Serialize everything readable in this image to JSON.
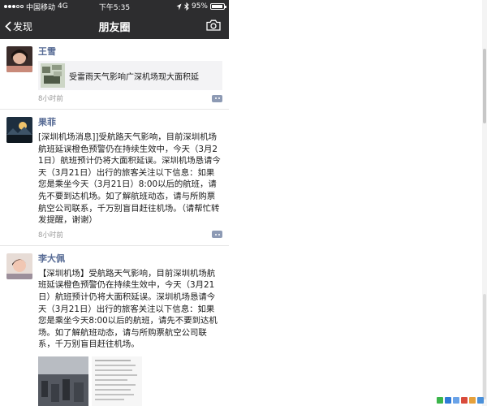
{
  "status_bar": {
    "carrier": "中国移动",
    "network": "4G",
    "time": "下午5:35",
    "battery": "95%",
    "battery_level": 0.95
  },
  "nav": {
    "back_label": "发现",
    "title": "朋友圈",
    "back_icon": "chevron-left-icon",
    "camera_icon": "camera-icon"
  },
  "posts": [
    {
      "author": "王雪",
      "link_title": "受雷雨天气影响广深机场现大面积延",
      "time": "8小时前"
    },
    {
      "author": "果菲",
      "text": "[深圳机场消息]]受航路天气影响，目前深圳机场航班延误橙色预警仍在持续生效中，今天（3月21日）航班预计仍将大面积延误。深圳机场恳请今天（3月21日）出行的旅客关注以下信息：如果您是乘坐今天（3月21日）8:00以后的航班，请先不要到达机场。如了解航班动态，请与所购票航空公司联系，千万别盲目赶往机场。（请帮忙转发提醒，谢谢）",
      "time": "8小时前"
    },
    {
      "author": "李大佩",
      "text": "【深圳机场】受航路天气影响，目前深圳机场航班延误橙色预警仍在持续生效中，今天（3月21日）航班预计仍将大面积延误。深圳机场恳请今天（3月21日）出行的旅客关注以下信息：如果您是乘坐今天8:00以后的航班，请先不要到达机场。如了解航班动态，请与所购票航空公司联系，千万别盲目赶往机场。"
    }
  ],
  "colors": {
    "nav_bg": "#2d2d2f",
    "author": "#576b95",
    "link_bg": "#f3f3f5",
    "comment_btn": "#8d9ab4"
  }
}
